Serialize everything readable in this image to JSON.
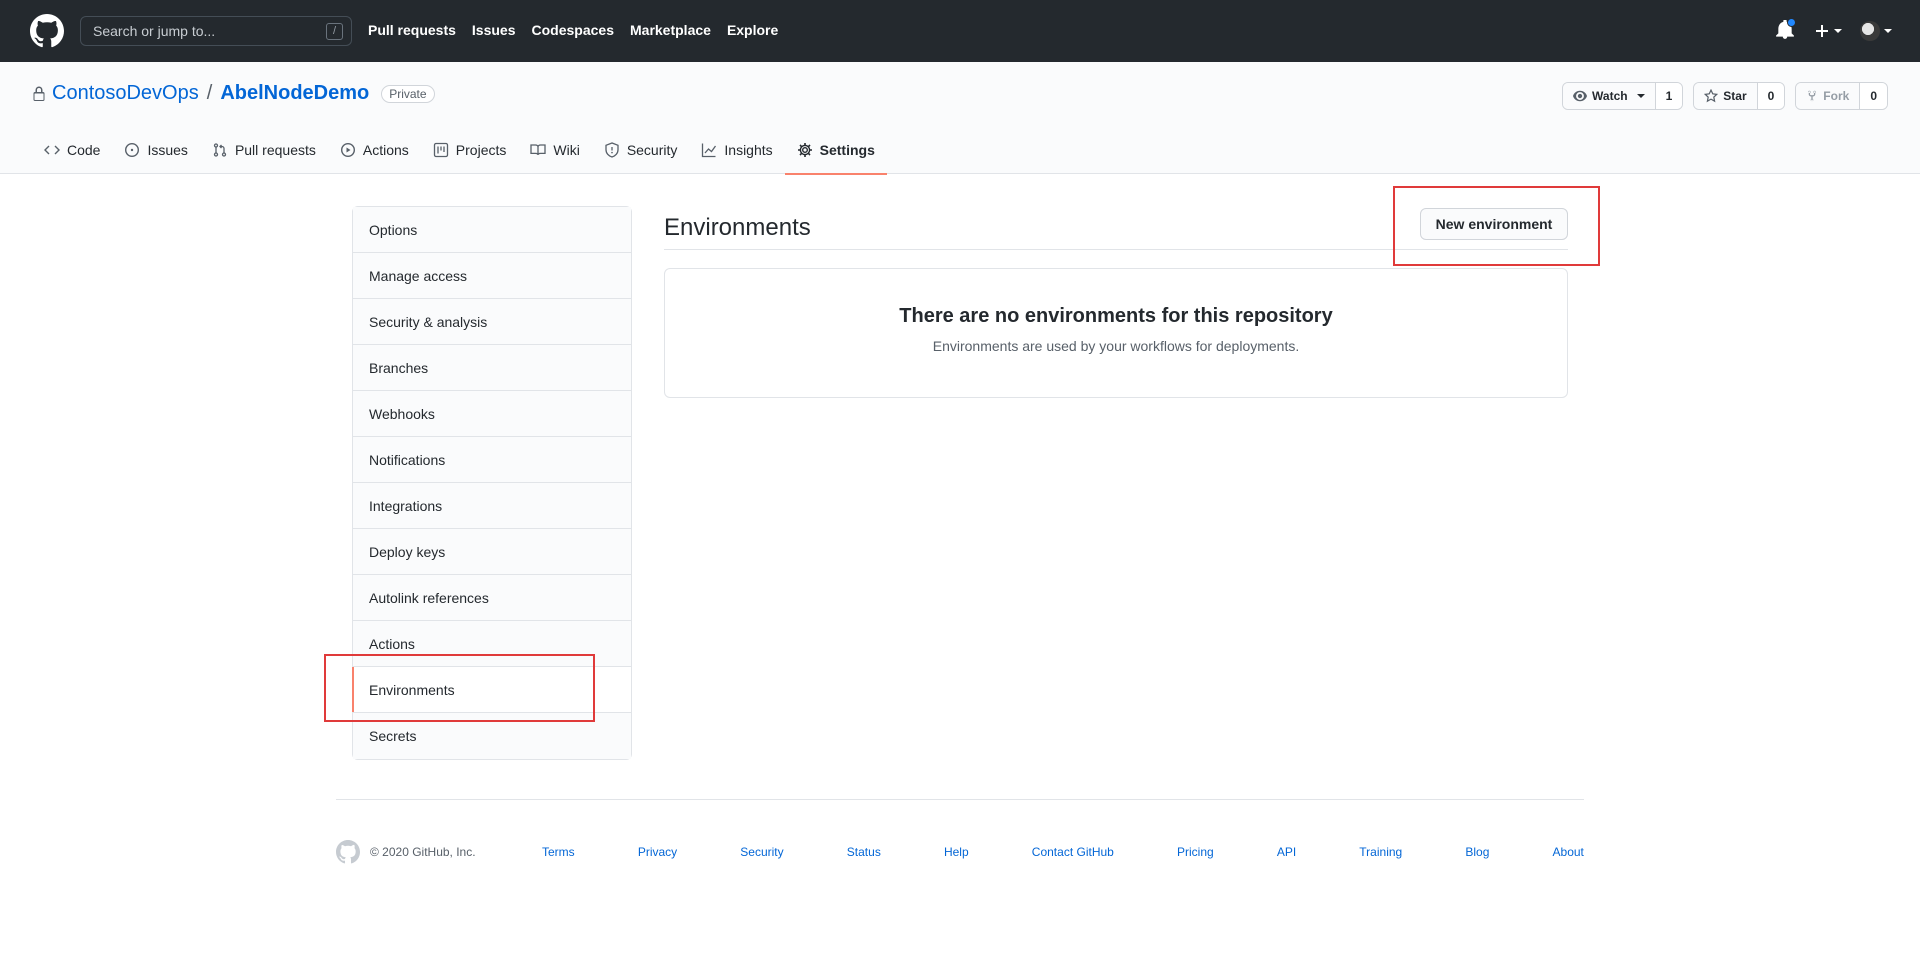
{
  "header": {
    "search_placeholder": "Search or jump to...",
    "search_shortcut": "/",
    "nav": [
      "Pull requests",
      "Issues",
      "Codespaces",
      "Marketplace",
      "Explore"
    ]
  },
  "repo": {
    "owner": "ContosoDevOps",
    "separator": "/",
    "name": "AbelNodeDemo",
    "visibility": "Private",
    "watch_label": "Watch",
    "watch_count": "1",
    "star_label": "Star",
    "star_count": "0",
    "fork_label": "Fork",
    "fork_count": "0",
    "tabs": [
      {
        "label": "Code",
        "icon": "code-icon"
      },
      {
        "label": "Issues",
        "icon": "issue-icon"
      },
      {
        "label": "Pull requests",
        "icon": "pull-request-icon"
      },
      {
        "label": "Actions",
        "icon": "play-icon"
      },
      {
        "label": "Projects",
        "icon": "project-icon"
      },
      {
        "label": "Wiki",
        "icon": "book-icon"
      },
      {
        "label": "Security",
        "icon": "shield-icon"
      },
      {
        "label": "Insights",
        "icon": "graph-icon"
      },
      {
        "label": "Settings",
        "icon": "gear-icon",
        "active": true
      }
    ]
  },
  "sidebar": {
    "items": [
      {
        "label": "Options"
      },
      {
        "label": "Manage access"
      },
      {
        "label": "Security & analysis"
      },
      {
        "label": "Branches"
      },
      {
        "label": "Webhooks"
      },
      {
        "label": "Notifications"
      },
      {
        "label": "Integrations"
      },
      {
        "label": "Deploy keys"
      },
      {
        "label": "Autolink references"
      },
      {
        "label": "Actions"
      },
      {
        "label": "Environments",
        "selected": true
      },
      {
        "label": "Secrets"
      }
    ]
  },
  "main": {
    "title": "Environments",
    "new_button": "New environment",
    "blank_title": "There are no environments for this repository",
    "blank_text": "Environments are used by your workflows for deployments."
  },
  "footer": {
    "copyright": "© 2020 GitHub, Inc.",
    "links": [
      "Terms",
      "Privacy",
      "Security",
      "Status",
      "Help",
      "Contact GitHub",
      "Pricing",
      "API",
      "Training",
      "Blog",
      "About"
    ]
  },
  "colors": {
    "header_bg": "#24292e",
    "link_blue": "#0366d6",
    "active_tab_underline": "#f9826c",
    "annotation_red": "#e03a3a",
    "notification_dot": "#2188ff"
  }
}
